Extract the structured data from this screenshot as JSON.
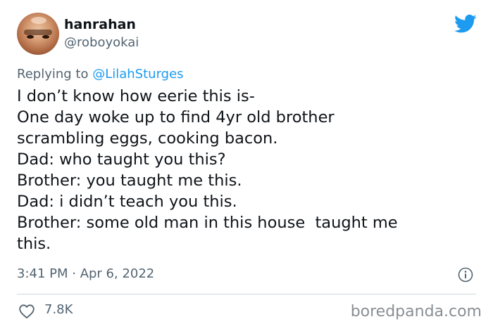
{
  "author": {
    "display_name": "hanrahan",
    "handle": "@roboyokai"
  },
  "reply": {
    "prefix": "Replying to ",
    "mention": "@LilahSturges"
  },
  "tweet": {
    "lines": [
      "I don’t know how eerie this is-",
      "One day woke up to find 4yr old brother",
      "scrambling eggs, cooking bacon.",
      "Dad: who taught you this?",
      "Brother: you taught me this.",
      "Dad: i didn’t teach you this.",
      "Brother: some old man in this house  taught me",
      "this."
    ],
    "timestamp": "3:41 PM · Apr 6, 2022"
  },
  "engagement": {
    "likes": "7.8K"
  },
  "watermark": "boredpanda.com",
  "icons": {
    "brand": "twitter-bird-icon",
    "info": "info-icon",
    "like": "heart-icon"
  },
  "colors": {
    "brand_blue": "#1d9bf0",
    "text_primary": "#0f1419",
    "text_secondary": "#536471",
    "divider": "#cfd9de"
  }
}
